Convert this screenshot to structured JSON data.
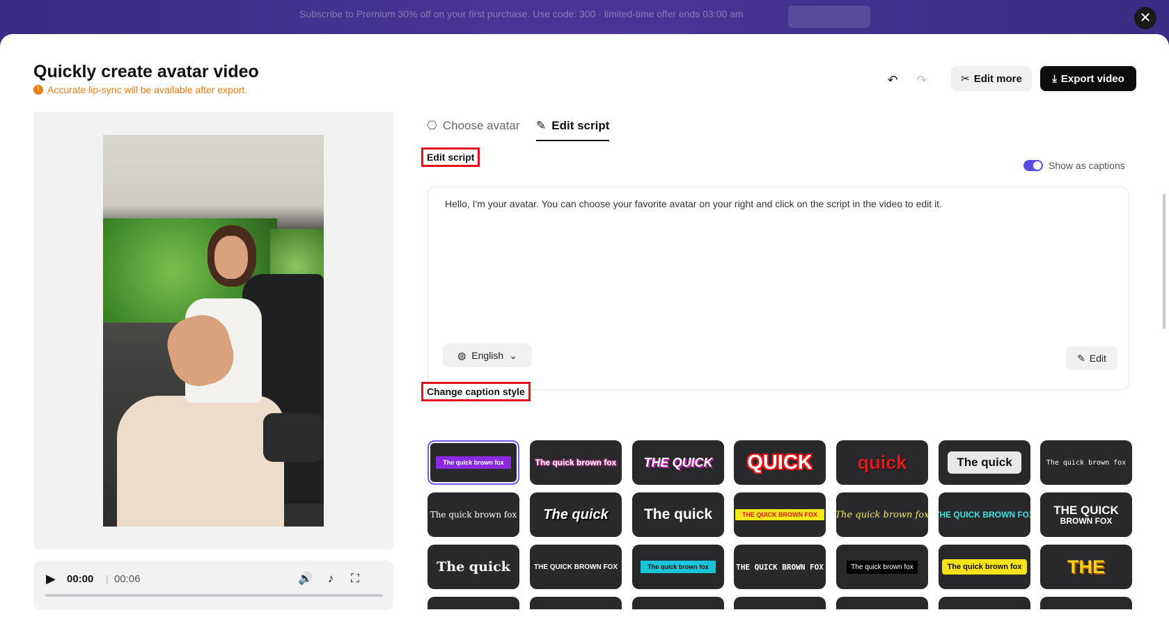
{
  "topbar": {
    "promo_text": "Subscribe to Premium 30% off on your first purchase. Use code: 300 · limited-time offer ends 03:00 am"
  },
  "header": {
    "title": "Quickly create avatar video",
    "warning": "Accurate lip-sync will be available after export.",
    "edit_more_label": "Edit more",
    "export_label": "Export video"
  },
  "player": {
    "current_time": "00:00",
    "separator": "|",
    "duration": "00:06",
    "progress": 0.0
  },
  "tabs": [
    {
      "label": "Choose avatar",
      "active": false
    },
    {
      "label": "Edit script",
      "active": true
    }
  ],
  "edit_script": {
    "section_label": "Edit script",
    "captions_toggle_label": "Show as captions",
    "captions_enabled": true,
    "script_text": "Hello, I'm your avatar. You can choose your favorite avatar on your right and click on the script in the video to edit it.",
    "language": "English",
    "edit_label": "Edit"
  },
  "caption_styles": {
    "section_label": "Change caption style",
    "items": [
      {
        "text": "The quick brown fox",
        "selected": true
      },
      {
        "text": "The quick brown fox"
      },
      {
        "text": "THE QUICK"
      },
      {
        "text": "QUICK"
      },
      {
        "text": "quick"
      },
      {
        "text": "The quick"
      },
      {
        "text": "The quick brown fox"
      },
      {
        "text": "The quick brown fox"
      },
      {
        "text": "The quick"
      },
      {
        "text": "The quick"
      },
      {
        "text": "THE QUICK BROWN FOX"
      },
      {
        "text": "The quick brown fox"
      },
      {
        "text": "THE QUICK BROWN FOX"
      },
      {
        "text": "THE QUICK"
      },
      {
        "text": "BROWN FOX"
      },
      {
        "text": "The quick"
      },
      {
        "text": "THE QUICK BROWN FOX"
      },
      {
        "text": "The quick brown fox"
      },
      {
        "text": "THE QUICK BROWN FOX"
      },
      {
        "text": "The quick brown fox"
      },
      {
        "text": "The quick brown fox"
      },
      {
        "text": "THE"
      }
    ]
  },
  "colors": {
    "accent": "#5b4ce0",
    "warning": "#f07c12",
    "highlight_box": "#e3101d",
    "topbar": "#3b2a7a"
  }
}
